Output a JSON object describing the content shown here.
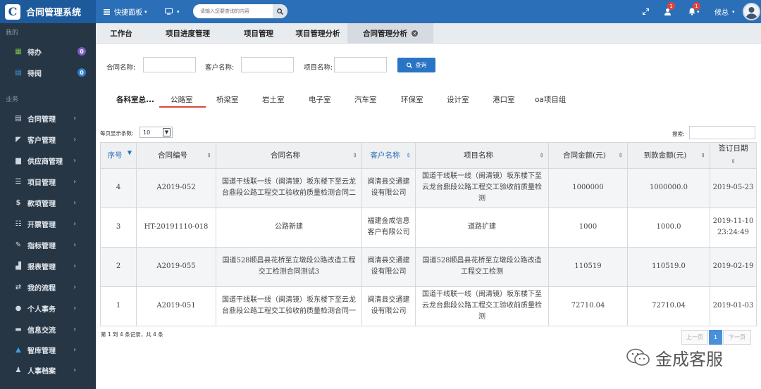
{
  "app": {
    "title": "合同管理系统"
  },
  "topbar": {
    "quick_panel": "快捷面板",
    "search_placeholder": "请输入您要查询的内容",
    "badge_msg": "1",
    "badge_bell": "1",
    "user": "候总"
  },
  "sidebar": {
    "section_mine": "我的",
    "todo": {
      "label": "待办",
      "count": "0"
    },
    "read": {
      "label": "待阅",
      "count": "0"
    },
    "section_biz": "业务",
    "items": [
      {
        "label": "合同管理"
      },
      {
        "label": "客户管理"
      },
      {
        "label": "供应商管理"
      },
      {
        "label": "项目管理"
      },
      {
        "label": "款项管理"
      },
      {
        "label": "开票管理"
      },
      {
        "label": "指标管理"
      },
      {
        "label": "报表管理"
      },
      {
        "label": "我的流程"
      },
      {
        "label": "个人事务"
      },
      {
        "label": "信息交流"
      },
      {
        "label": "智库管理"
      },
      {
        "label": "人事档案"
      }
    ]
  },
  "tabs": [
    {
      "label": "工作台"
    },
    {
      "label": "项目进度管理"
    },
    {
      "label": "项目管理"
    },
    {
      "label": "项目管理分析"
    },
    {
      "label": "合同管理分析"
    }
  ],
  "filters": {
    "contract_name_label": "合同名称:",
    "customer_name_label": "客户名称:",
    "project_name_label": "项目名称:",
    "query_label": "查询"
  },
  "dept_tabs": [
    {
      "label": "各科室总..."
    },
    {
      "label": "公路室"
    },
    {
      "label": "桥梁室"
    },
    {
      "label": "岩土室"
    },
    {
      "label": "电子室"
    },
    {
      "label": "汽车室"
    },
    {
      "label": "环保室"
    },
    {
      "label": "设计室"
    },
    {
      "label": "港口室"
    },
    {
      "label": "oa项目组"
    }
  ],
  "list": {
    "per_page_label": "每页显示条数:",
    "per_page_value": "10",
    "search_label": "搜索:"
  },
  "table": {
    "headers": {
      "seq": "序号",
      "code": "合同编号",
      "name": "合同名称",
      "customer": "客户名称",
      "project": "项目名称",
      "amount": "合同金额(元)",
      "received": "到款金额(元)",
      "date": "签订日期"
    },
    "rows": [
      {
        "seq": "4",
        "code": "A2019-052",
        "name": "国道干线联一线（闽清镜）坂东楼下至云龙台鼎段公路工程交工验收前质量检测合同二",
        "customer": "闽清县交通建设有限公司",
        "project": "国道干线联一线（闽清镜）坂东楼下至云龙台鼎段公路工程交工验收前质量检测",
        "amount": "1000000",
        "received": "1000000.0",
        "date": "2019-05-23"
      },
      {
        "seq": "3",
        "code": "HT-20191110-018",
        "name": "公路新建",
        "customer": "福建金成信息客户有限公司",
        "project": "道路扩建",
        "amount": "1000",
        "received": "1000.0",
        "date": "2019-11-10 23:24:49"
      },
      {
        "seq": "2",
        "code": "A2019-055",
        "name": "国道528顺昌县花桥至立墩段公路改造工程交工检测合同测试3",
        "customer": "闽清县交通建设有限公司",
        "project": "国道528顺昌县花桥至立墩段公路改造工程交工检测",
        "amount": "110519",
        "received": "110519.0",
        "date": "2019-02-19"
      },
      {
        "seq": "1",
        "code": "A2019-051",
        "name": "国道干线联一线（闽清镜）坂东楼下至云龙台鼎段公路工程交工验收前质量检测合同一",
        "customer": "闽清县交通建设有限公司",
        "project": "国道干线联一线（闽清镜）坂东楼下至云龙台鼎段公路工程交工验收前质量检测",
        "amount": "72710.04",
        "received": "72710.04",
        "date": "2019-01-03"
      }
    ]
  },
  "pagination": {
    "info": "第 1 到 4 条记录，共 4 条",
    "prev": "上一页",
    "current": "1",
    "next": "下一页"
  },
  "watermark": {
    "text": "金成客服"
  }
}
